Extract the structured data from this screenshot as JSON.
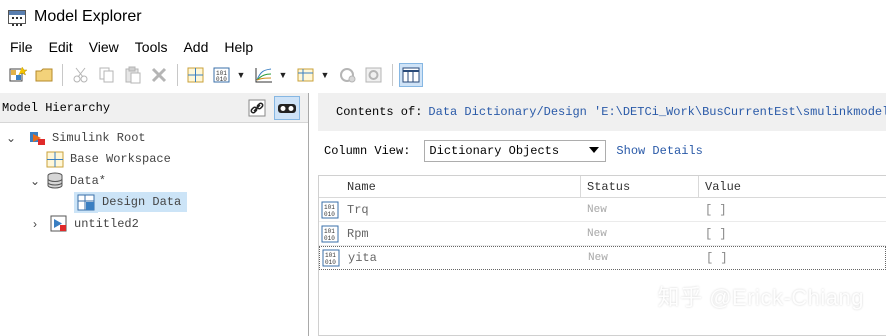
{
  "window": {
    "title": "Model Explorer",
    "icon": "model-explorer-icon"
  },
  "menu": [
    "File",
    "Edit",
    "View",
    "Tools",
    "Add",
    "Help"
  ],
  "toolbar": {
    "buttons": [
      "new-model-icon",
      "open-folder-icon",
      "cut-icon",
      "copy-icon",
      "paste-icon",
      "delete-icon",
      "add-grid-icon",
      "add-data-icon",
      "add-plot-icon",
      "add-table-icon",
      "run-icon",
      "settings-icon",
      "column-view-icon"
    ],
    "active": "column-view-icon"
  },
  "left": {
    "header": "Model Hierarchy",
    "tree": [
      {
        "label": "Simulink Root",
        "expanded": true,
        "icon": "simulink-root-icon"
      },
      {
        "label": "Base Workspace",
        "icon": "workspace-grid-icon"
      },
      {
        "label": "Data*",
        "expanded": true,
        "icon": "database-icon"
      },
      {
        "label": "Design Data",
        "icon": "design-data-icon",
        "selected": true
      },
      {
        "label": "untitled2",
        "expanded": false,
        "icon": "model-icon"
      }
    ]
  },
  "right": {
    "contents_prefix": "Contents of:",
    "contents_path": "Data Dictionary/Design 'E:\\DETCi_Work\\BusCurrentEst\\smulinkmodel_Lo",
    "column_view_label": "Column View:",
    "column_view_value": "Dictionary Objects",
    "show_details": "Show Details",
    "columns": [
      "Name",
      "Status",
      "Value"
    ],
    "rows": [
      {
        "name": "Trq",
        "status": "New",
        "value": "[ ]"
      },
      {
        "name": "Rpm",
        "status": "New",
        "value": "[ ]"
      },
      {
        "name": "yita",
        "status": "New",
        "value": "[ ]"
      }
    ]
  },
  "watermark": "知乎 @Erick-Chiang",
  "colors": {
    "selection": "#cce4f7",
    "link": "#2a5aa8",
    "toolbar_active": "#cfe3f7"
  }
}
